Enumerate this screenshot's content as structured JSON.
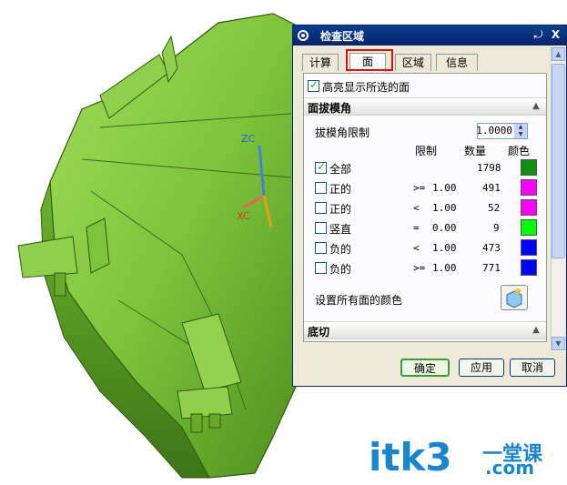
{
  "dialog": {
    "title": "检查区域",
    "pin": "⤾",
    "close": "X",
    "tabs": [
      {
        "label": "计算",
        "active": false
      },
      {
        "label": "面",
        "active": true
      },
      {
        "label": "区域",
        "active": false
      },
      {
        "label": "信息",
        "active": false
      }
    ],
    "highlight_checkbox": {
      "label": "高亮显示所选的面",
      "checked": true
    },
    "section_draft": {
      "title": "面拔模角",
      "limit_label": "拔模角限制",
      "limit_value": "1.0000",
      "col_limit": "限制",
      "col_count": "数量",
      "col_color": "颜色",
      "rows": [
        {
          "label": "全部",
          "checked": true,
          "op": "",
          "limit": "",
          "count": "1798",
          "color": "#109010"
        },
        {
          "label": "正的",
          "checked": false,
          "op": ">=",
          "limit": "1.00",
          "count": "491",
          "color": "#ff00ff"
        },
        {
          "label": "正的",
          "checked": false,
          "op": "<",
          "limit": "1.00",
          "count": "52",
          "color": "#ff00ff"
        },
        {
          "label": "竖直",
          "checked": false,
          "op": "=",
          "limit": "0.00",
          "count": "9",
          "color": "#00ff00"
        },
        {
          "label": "负的",
          "checked": false,
          "op": "<",
          "limit": "1.00",
          "count": "473",
          "color": "#0000ff"
        },
        {
          "label": "负的",
          "checked": false,
          "op": ">=",
          "limit": "1.00",
          "count": "771",
          "color": "#0000ff"
        }
      ],
      "set_color_label": "设置所有面的颜色"
    },
    "section_undercut": {
      "title": "底切"
    },
    "buttons": {
      "ok": "确定",
      "apply": "应用",
      "cancel": "取消"
    }
  },
  "viewport": {
    "axis_z": "ZC",
    "axis_x": "XC",
    "model_color": "#7ac233"
  },
  "watermark": {
    "main": "itk3",
    "sub1": "一堂课",
    "sub2": ".com"
  }
}
